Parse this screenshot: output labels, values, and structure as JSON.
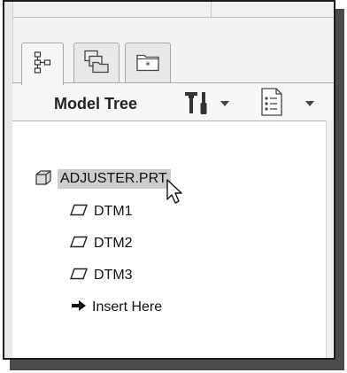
{
  "tabs": [
    {
      "icon": "model-tree-icon",
      "active": true
    },
    {
      "icon": "folder-browser-icon",
      "active": false
    },
    {
      "icon": "favorites-icon",
      "active": false
    }
  ],
  "header": {
    "title": "Model Tree",
    "settings_icon": "tools-icon",
    "show_icon": "list-icon"
  },
  "tree": {
    "root": {
      "label": "ADJUSTER.PRT",
      "icon": "part-cube-icon"
    },
    "items": [
      {
        "label": "DTM1",
        "icon": "datum-plane-icon"
      },
      {
        "label": "DTM2",
        "icon": "datum-plane-icon"
      },
      {
        "label": "DTM3",
        "icon": "datum-plane-icon"
      },
      {
        "label": "Insert Here",
        "icon": "insert-arrow-icon"
      }
    ]
  }
}
